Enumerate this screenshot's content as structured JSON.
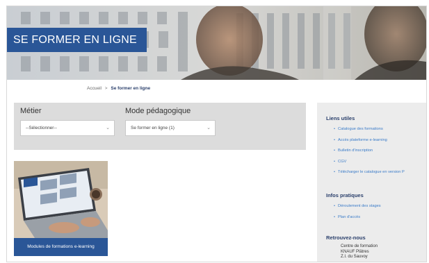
{
  "hero": {
    "title": "SE FORMER EN LIGNE",
    "accent": "#2a5697"
  },
  "breadcrumb": {
    "home": "Accueil",
    "separator": ">",
    "current": "Se former en ligne"
  },
  "filters": {
    "metier": {
      "label": "Métier",
      "value": "--Sélectionner--"
    },
    "mode": {
      "label": "Mode pédagogique",
      "value": "Se former en ligne (1)"
    }
  },
  "card": {
    "caption": "Modules de formations e-learning"
  },
  "sidebar": {
    "liens_heading": "Liens utiles",
    "liens": [
      "Catalogue des formations",
      "Accès plateforme e-learning",
      "Bulletin d'inscription",
      "CGV",
      "Télécharger le catalogue en version P"
    ],
    "infos_heading": "Infos pratiques",
    "infos": [
      "Déroulement des stages",
      "Plan d'accès"
    ],
    "retrouvez_heading": "Retrouvez-nous",
    "address": [
      "Centre de formation",
      "KNAUF Plâtres",
      "Z.I. du Sauvoy"
    ],
    "link_color": "#3a7bc8"
  }
}
